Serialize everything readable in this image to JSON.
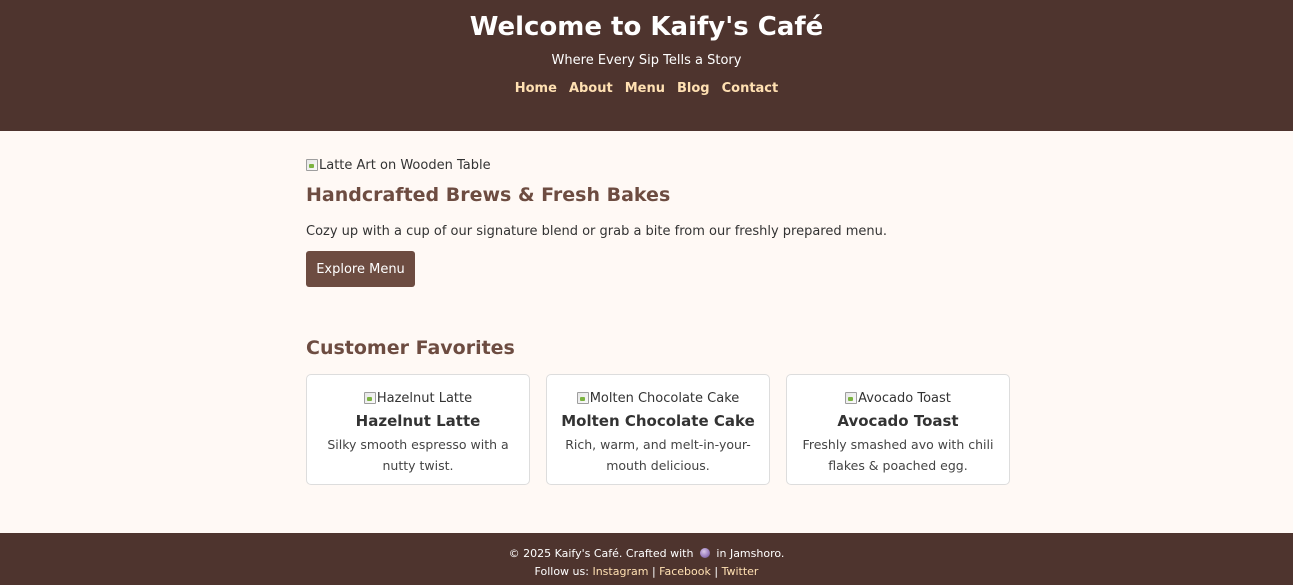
{
  "header": {
    "title": "Welcome to Kaify's Café",
    "tagline": "Where Every Sip Tells a Story",
    "nav": [
      "Home",
      "About",
      "Menu",
      "Blog",
      "Contact"
    ]
  },
  "hero": {
    "image_alt": "Latte Art on Wooden Table",
    "heading": "Handcrafted Brews & Fresh Bakes",
    "text": "Cozy up with a cup of our signature blend or grab a bite from our freshly prepared menu.",
    "button_label": "Explore Menu"
  },
  "favorites": {
    "heading": "Customer Favorites",
    "items": [
      {
        "image_alt": "Hazelnut Latte",
        "title": "Hazelnut Latte",
        "description": "Silky smooth espresso with a nutty twist."
      },
      {
        "image_alt": "Molten Chocolate Cake",
        "title": "Molten Chocolate Cake",
        "description": "Rich, warm, and melt-in-your-mouth delicious."
      },
      {
        "image_alt": "Avocado Toast",
        "title": "Avocado Toast",
        "description": "Freshly smashed avo with chili flakes & poached egg."
      }
    ]
  },
  "footer": {
    "copyright_prefix": "© 2025 Kaify's Café. Crafted with",
    "copyright_suffix": "in Jamshoro.",
    "follow_label": "Follow us:",
    "links": [
      "Instagram",
      "Facebook",
      "Twitter"
    ],
    "separator": "|"
  },
  "icons": {
    "broken_image": "broken-image-icon",
    "crafted_with": "coffee-icon"
  },
  "colors": {
    "header_bg": "#4e342e",
    "accent_brown": "#6d4c41",
    "nav_link": "#ffe0b2",
    "page_bg": "#fff9f5"
  }
}
